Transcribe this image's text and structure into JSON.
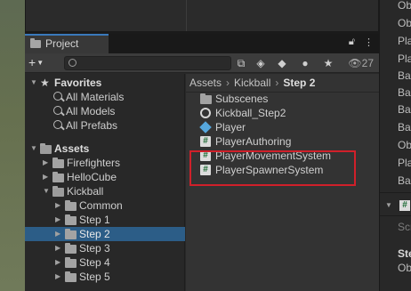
{
  "panel": {
    "tab_label": "Project",
    "hidden_count": "27"
  },
  "favorites": {
    "title": "Favorites",
    "items": [
      "All Materials",
      "All Models",
      "All Prefabs"
    ]
  },
  "tree": {
    "root": "Assets",
    "items": [
      {
        "label": "Firefighters"
      },
      {
        "label": "HelloCube"
      },
      {
        "label": "Kickball"
      },
      {
        "label": "Common"
      },
      {
        "label": "Step 1"
      },
      {
        "label": "Step 2"
      },
      {
        "label": "Step 3"
      },
      {
        "label": "Step 4"
      },
      {
        "label": "Step 5"
      }
    ]
  },
  "breadcrumb": {
    "parts": [
      "Assets",
      "Kickball"
    ],
    "current": "Step 2",
    "separator": "›"
  },
  "files": [
    {
      "name": "Subscenes",
      "icon": "folder-icon"
    },
    {
      "name": "Kickball_Step2",
      "icon": "unity-scene-icon"
    },
    {
      "name": "Player",
      "icon": "prefab-cube-icon"
    },
    {
      "name": "PlayerAuthoring",
      "icon": "csharp-script-icon"
    },
    {
      "name": "PlayerMovementSystem",
      "icon": "csharp-script-icon"
    },
    {
      "name": "PlayerSpawnerSystem",
      "icon": "csharp-script-icon"
    }
  ],
  "inspector": {
    "rows": [
      "Ob",
      "Ob",
      "Pla",
      "Pla",
      "Bal",
      "Bal",
      "Bal",
      "Bal",
      "Ob",
      "Pla",
      "Bal"
    ],
    "script_row": "#",
    "dim_row": "Scr",
    "bold_row": "Ste",
    "last_row": "Ob"
  },
  "colors": {
    "selection": "#2c5d87",
    "tab_accent": "#3a79bb",
    "highlight_box": "#d0202a",
    "script_icon_text": "#1d6b35"
  }
}
